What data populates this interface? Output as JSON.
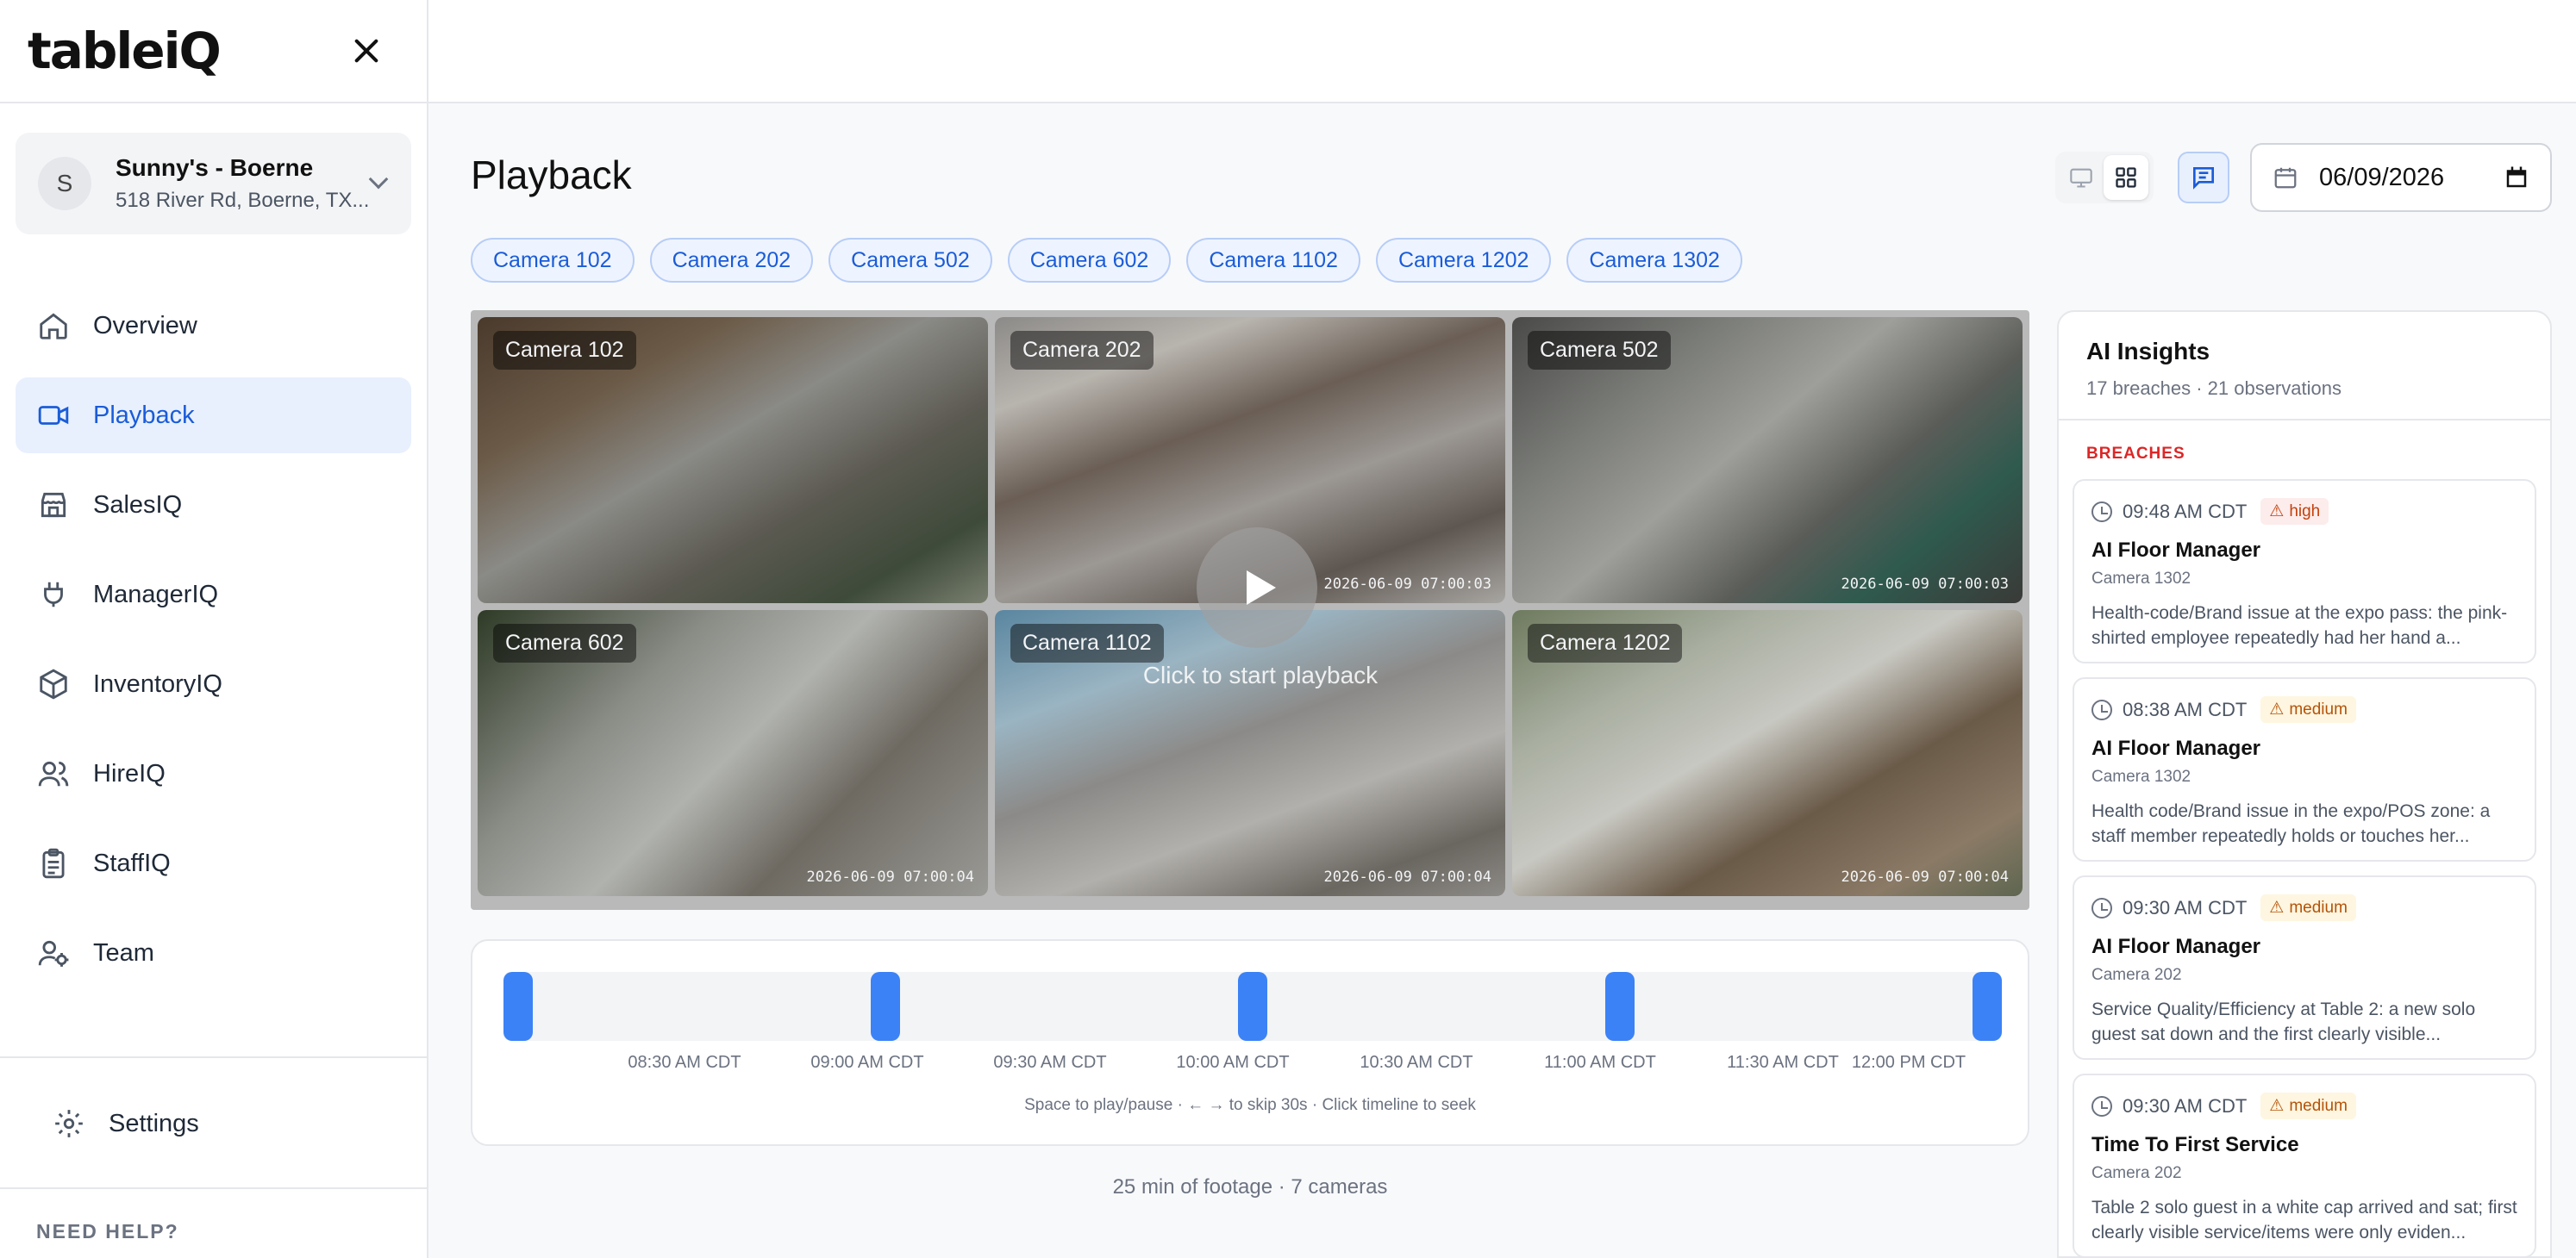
{
  "brand": {
    "logo": "tableiQ"
  },
  "location": {
    "initial": "S",
    "name": "Sunny's - Boerne",
    "address": "518 River Rd, Boerne, TX..."
  },
  "nav": [
    {
      "label": "Overview",
      "icon": "home-icon"
    },
    {
      "label": "Playback",
      "icon": "video-camera-icon",
      "active": true
    },
    {
      "label": "SalesIQ",
      "icon": "store-icon"
    },
    {
      "label": "ManagerIQ",
      "icon": "plug-icon"
    },
    {
      "label": "InventoryIQ",
      "icon": "box-icon"
    },
    {
      "label": "HireIQ",
      "icon": "users-icon"
    },
    {
      "label": "StaffIQ",
      "icon": "clipboard-icon"
    },
    {
      "label": "Team",
      "icon": "user-gear-icon"
    }
  ],
  "settings_label": "Settings",
  "need_help": "NEED HELP?",
  "page": {
    "title": "Playback"
  },
  "date": {
    "value": "06/09/2026"
  },
  "camera_chips": [
    "Camera 102",
    "Camera 202",
    "Camera 502",
    "Camera 602",
    "Camera 1102",
    "Camera 1202",
    "Camera 1302"
  ],
  "cameras": [
    {
      "label": "Camera 102",
      "timestamp": ""
    },
    {
      "label": "Camera 202",
      "timestamp": "2026-06-09 07:00:03"
    },
    {
      "label": "Camera 502",
      "timestamp": "2026-06-09 07:00:03"
    },
    {
      "label": "Camera 602",
      "timestamp": "2026-06-09 07:00:04"
    },
    {
      "label": "Camera 1102",
      "timestamp": "2026-06-09 07:00:04"
    },
    {
      "label": "Camera 1202",
      "timestamp": "2026-06-09 07:00:04"
    }
  ],
  "playback_hint": "Click to start playback",
  "timeline": {
    "ticks": [
      "08:30 AM CDT",
      "09:00 AM CDT",
      "09:30 AM CDT",
      "10:00 AM CDT",
      "10:30 AM CDT",
      "11:00 AM CDT",
      "11:30 AM CDT",
      "12:00 PM CDT"
    ],
    "help": "Space to play/pause · ← → to skip 30s · Click timeline to seek"
  },
  "footage_summary": "25 min of footage · 7 cameras",
  "insights": {
    "title": "AI Insights",
    "subtitle": "17 breaches · 21 observations",
    "section": "BREACHES",
    "cards": [
      {
        "time": "09:48 AM CDT",
        "severity": "high",
        "title": "AI Floor Manager",
        "camera": "Camera 1302",
        "desc": "Health-code/Brand issue at the expo pass: the pink-shirted employee repeatedly had her hand a..."
      },
      {
        "time": "08:38 AM CDT",
        "severity": "medium",
        "title": "AI Floor Manager",
        "camera": "Camera 1302",
        "desc": "Health code/Brand issue in the expo/POS zone: a staff member repeatedly holds or touches her..."
      },
      {
        "time": "09:30 AM CDT",
        "severity": "medium",
        "title": "AI Floor Manager",
        "camera": "Camera 202",
        "desc": "Service Quality/Efficiency at Table 2: a new solo guest sat down and the first clearly visible..."
      },
      {
        "time": "09:30 AM CDT",
        "severity": "medium",
        "title": "Time To First Service",
        "camera": "Camera 202",
        "desc": "Table 2 solo guest in a white cap arrived and sat; first clearly visible service/items were only eviden..."
      }
    ]
  },
  "colors": {
    "accent": "#1a5cd8",
    "accent_bg": "#e8f0fe",
    "marker": "#3b82f6",
    "breach": "#dc2626"
  }
}
